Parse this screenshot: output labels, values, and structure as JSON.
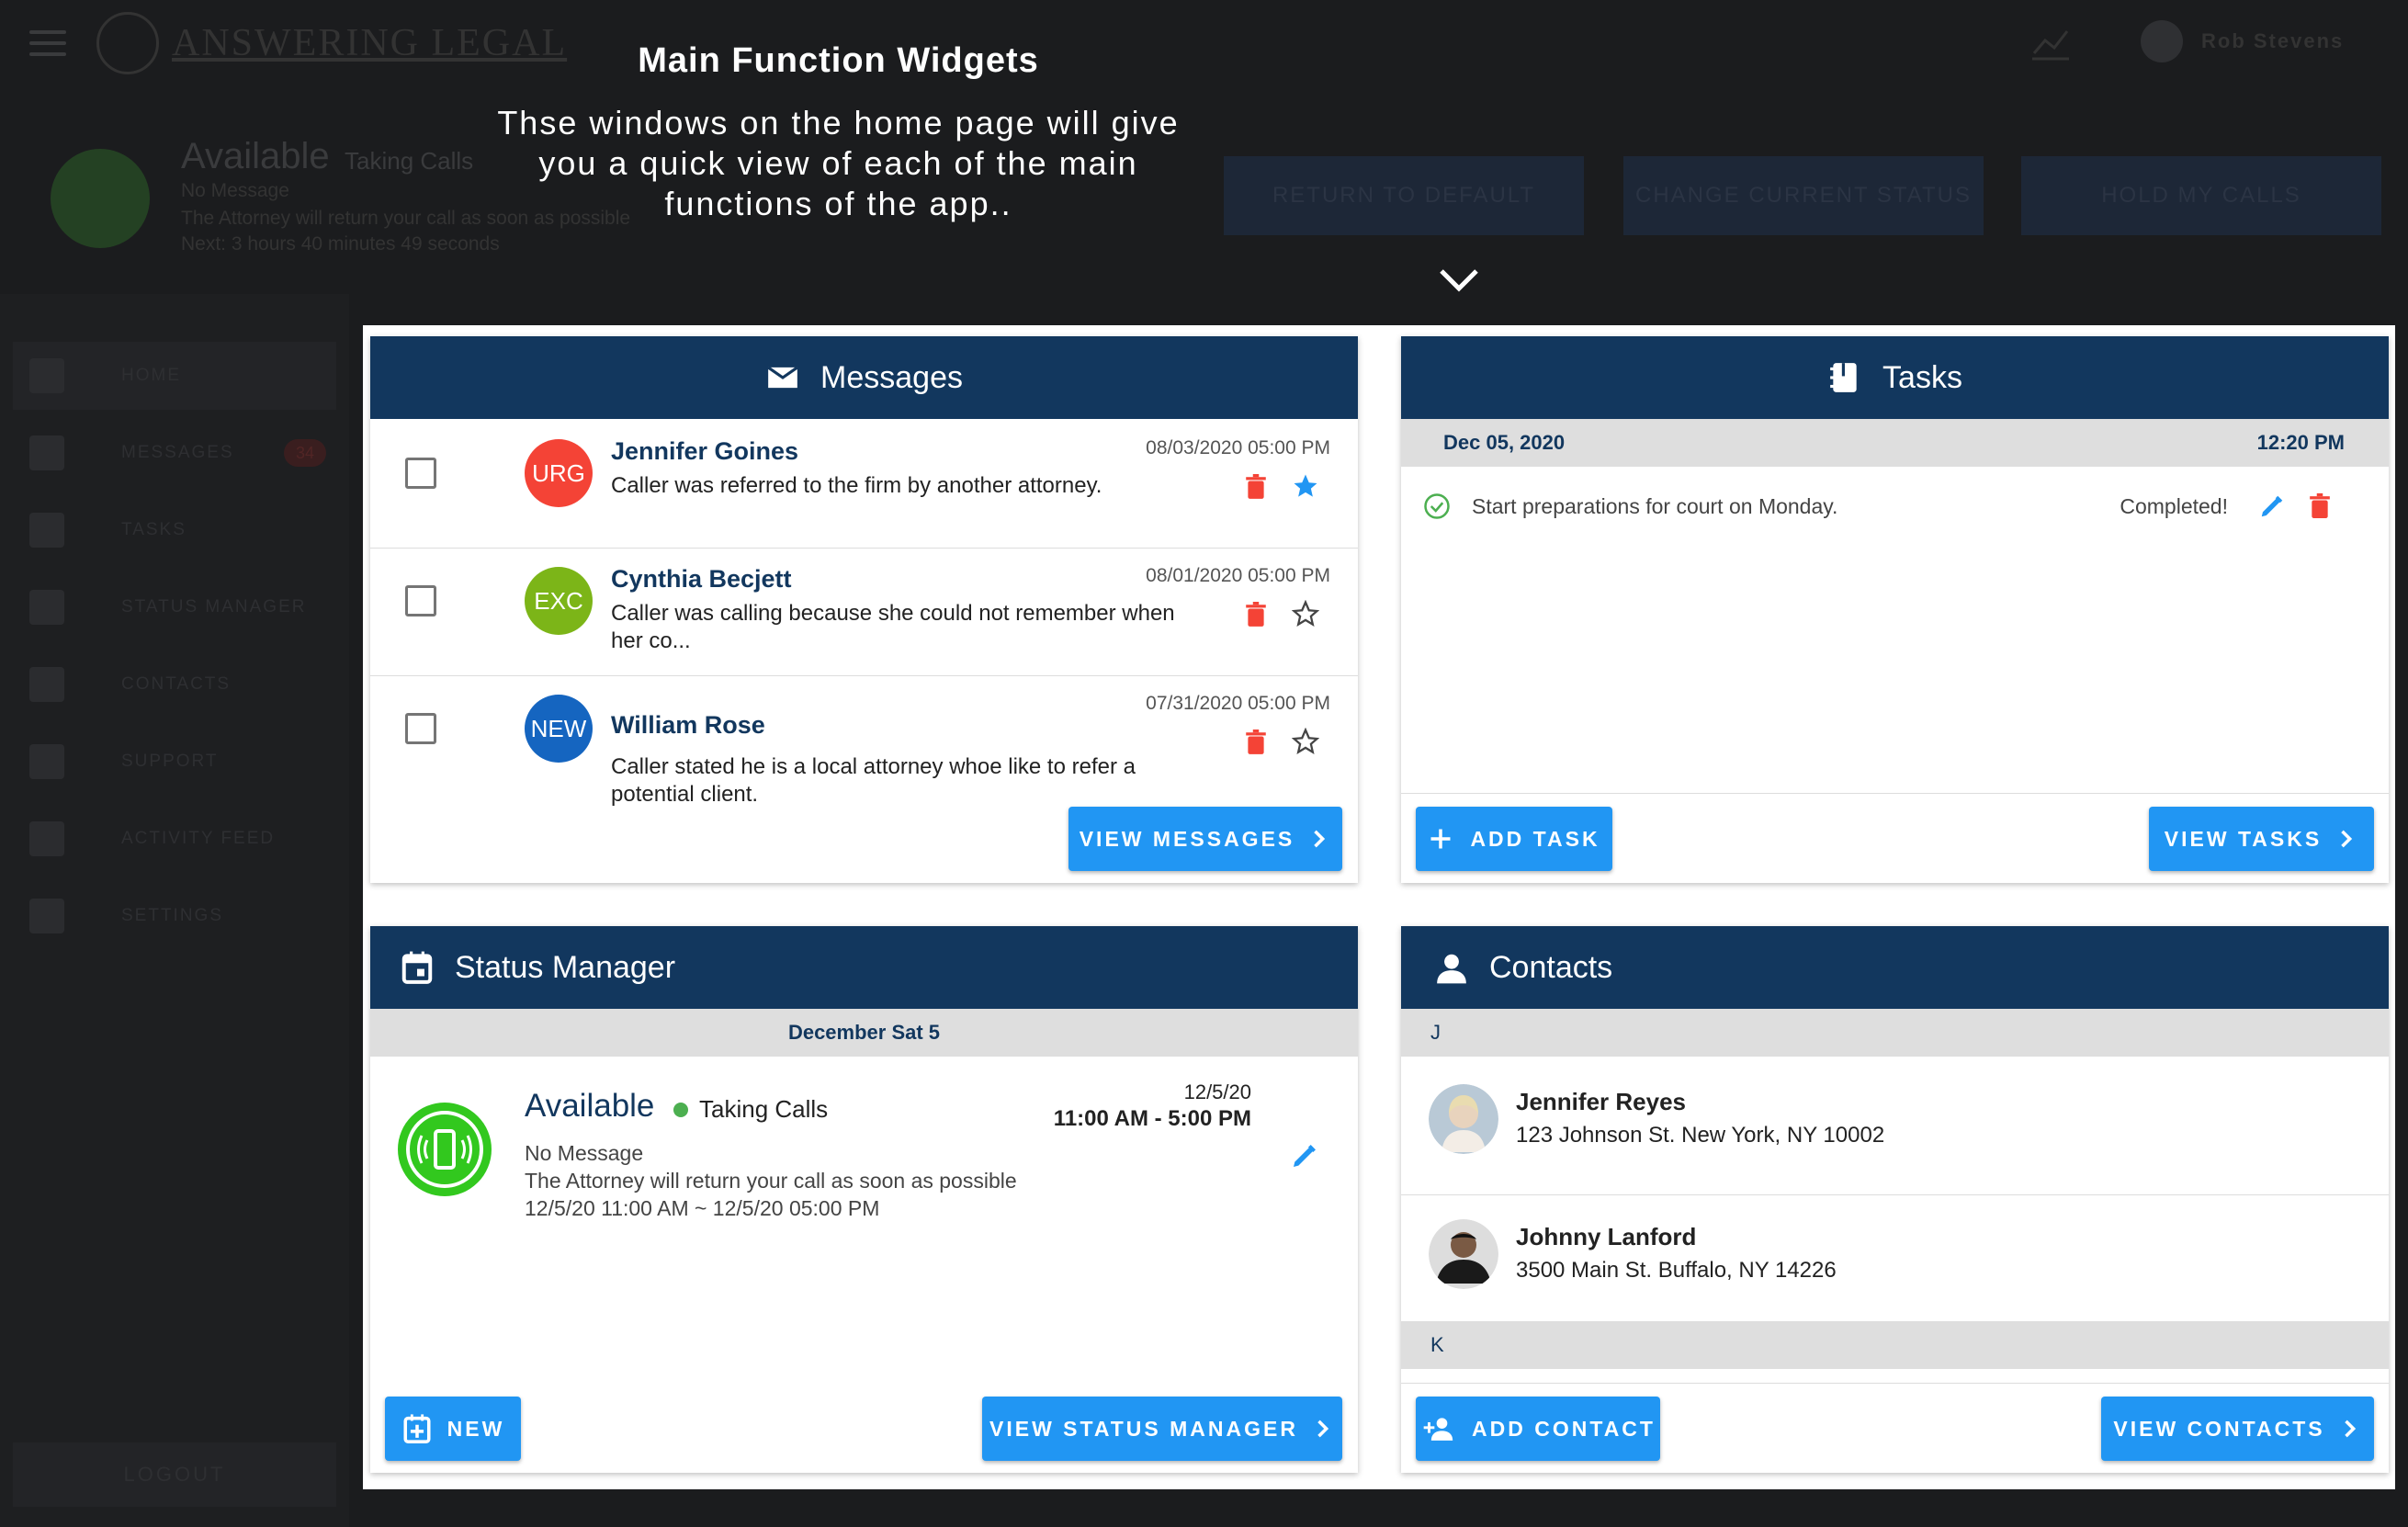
{
  "background_app": {
    "logo_text": "ANSWERING LEGAL",
    "user_name": "Rob Stevens",
    "status": {
      "title": "Available",
      "subtitle": "Taking Calls",
      "message": "No Message",
      "description": "The Attorney will return your call as soon as possible",
      "next": "Next:   3 hours   40 minutes   49 seconds"
    },
    "buttons": [
      "RETURN TO DEFAULT",
      "CHANGE CURRENT STATUS",
      "HOLD MY CALLS"
    ],
    "sidebar": [
      {
        "label": "HOME",
        "icon": "dashboard-icon"
      },
      {
        "label": "MESSAGES",
        "icon": "mail-icon"
      },
      {
        "label": "TASKS",
        "icon": "tasks-icon"
      },
      {
        "label": "STATUS MANAGER",
        "icon": "calendar-icon"
      },
      {
        "label": "CONTACTS",
        "icon": "person-icon"
      },
      {
        "label": "SUPPORT",
        "icon": "help-icon"
      },
      {
        "label": "ACTIVITY FEED",
        "icon": "monitor-icon"
      },
      {
        "label": "SETTINGS",
        "icon": "gear-icon"
      }
    ],
    "messages_badge": "34",
    "logout": "LOGOUT"
  },
  "tooltip": {
    "title": "Main Function Widgets",
    "body": "Thse windows on the home page will give you a quick view of each of the main functions of the app.."
  },
  "messages": {
    "title": "Messages",
    "items": [
      {
        "badge": "URG",
        "badge_color": "#f44336",
        "name": "Jennifer Goines",
        "date": "08/03/2020 05:00 PM",
        "text": "Caller was referred to the firm by another attorney.",
        "starred": true
      },
      {
        "badge": "EXC",
        "badge_color": "#7cb518",
        "name": "Cynthia Becjett",
        "date": "08/01/2020 05:00 PM",
        "text": "Caller was calling because she could not remember when her co...",
        "starred": false
      },
      {
        "badge": "NEW",
        "badge_color": "#1565c0",
        "name": "William Rose",
        "date": "07/31/2020 05:00 PM",
        "text": "Caller stated he is a local attorney whoe like to refer a potential client.",
        "starred": false
      }
    ],
    "view_button": "VIEW MESSAGES"
  },
  "tasks": {
    "title": "Tasks",
    "date": "Dec 05, 2020",
    "time": "12:20 PM",
    "items": [
      {
        "text": "Start preparations for court on Monday.",
        "status": "Completed!"
      }
    ],
    "add_button": "ADD TASK",
    "view_button": "VIEW TASKS"
  },
  "status_manager": {
    "title": "Status Manager",
    "date": "December Sat 5",
    "status_title": "Available",
    "status_sub": "Taking Calls",
    "message": "No Message",
    "description": "The Attorney will return your call as soon as possible",
    "range": "12/5/20 11:00 AM ~ 12/5/20 05:00 PM",
    "short_date": "12/5/20",
    "time_range": "11:00 AM - 5:00 PM",
    "new_button": "NEW",
    "view_button": "VIEW STATUS MANAGER",
    "accent": "#32c81e"
  },
  "contacts": {
    "title": "Contacts",
    "sections": [
      {
        "letter": "J",
        "items": [
          {
            "name": "Jennifer Reyes",
            "address": "123 Johnson St. New York, NY 10002"
          },
          {
            "name": "Johnny Lanford",
            "address": "3500 Main St. Buffalo, NY 14226"
          }
        ]
      },
      {
        "letter": "K",
        "items": []
      }
    ],
    "add_button": "ADD CONTACT",
    "view_button": "VIEW CONTACTS"
  },
  "colors": {
    "header": "#12375e",
    "primary": "#2196f3",
    "danger": "#f44336"
  }
}
